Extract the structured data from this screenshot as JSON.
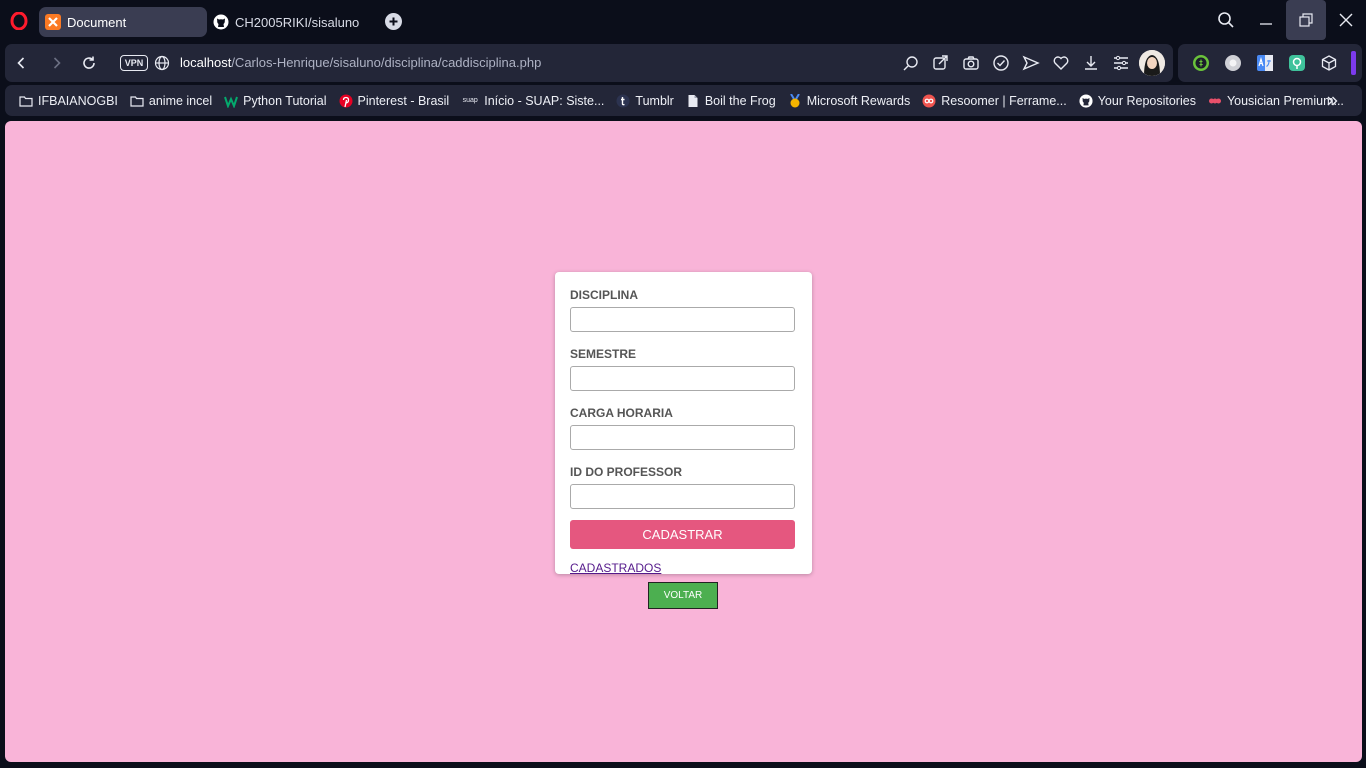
{
  "browser": {
    "tabs": [
      {
        "title": "Document",
        "active": true
      },
      {
        "title": "CH2005RIKI/sisaluno",
        "active": false
      }
    ],
    "address": {
      "vpn_badge": "VPN",
      "url_host": "localhost",
      "url_path": "/Carlos-Henrique/sisaluno/disciplina/caddisciplina.php"
    },
    "bookmarks": [
      {
        "label": "IFBAIANOGBI",
        "icon": "folder-icon"
      },
      {
        "label": "anime incel",
        "icon": "folder-icon"
      },
      {
        "label": "Python Tutorial",
        "icon": "w3schools-icon"
      },
      {
        "label": "Pinterest - Brasil",
        "icon": "pinterest-icon"
      },
      {
        "label": "Início - SUAP: Siste...",
        "icon": "suap-icon"
      },
      {
        "label": "Tumblr",
        "icon": "tumblr-icon"
      },
      {
        "label": "Boil the Frog",
        "icon": "page-icon"
      },
      {
        "label": "Microsoft Rewards",
        "icon": "medal-icon"
      },
      {
        "label": "Resoomer | Ferrame...",
        "icon": "resoomer-icon"
      },
      {
        "label": "Your Repositories",
        "icon": "github-icon"
      },
      {
        "label": "Yousician Premium...",
        "icon": "yousician-icon"
      }
    ],
    "suap_mark": "suap",
    "colors": {
      "tab_bar": "#0b0e1a",
      "toolbar": "#232638",
      "active_tab": "#3a3d52"
    }
  },
  "page": {
    "background": "#f9b4d8",
    "form": {
      "fields": [
        {
          "label": "DISCIPLINA",
          "value": ""
        },
        {
          "label": "SEMESTRE",
          "value": ""
        },
        {
          "label": "CARGA HORARIA",
          "value": ""
        },
        {
          "label": "ID DO PROFESSOR",
          "value": ""
        }
      ],
      "submit_label": "CADASTRAR",
      "link_label": "CADASTRADOS",
      "submit_color": "#e5577f"
    },
    "back_label": "VOLTAR",
    "back_color": "#4caf50"
  }
}
